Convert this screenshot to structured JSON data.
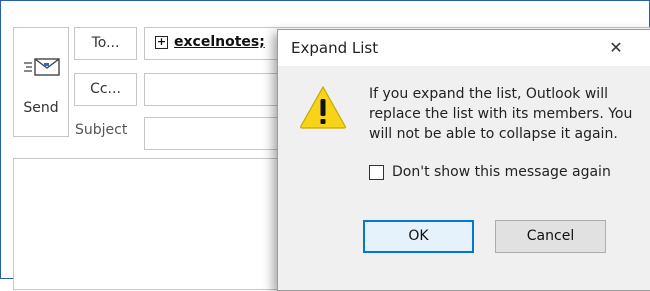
{
  "compose": {
    "send_label": "Send",
    "to_label": "To...",
    "cc_label": "Cc...",
    "subject_label": "Subject",
    "to_expand_glyph": "+",
    "to_value": "excelnotes;"
  },
  "dialog": {
    "title": "Expand List",
    "close_glyph": "✕",
    "message": "If you expand the list, Outlook will\nreplace the list with its members. You\nwill not be able to collapse it again.",
    "checkbox_label": "Don't show this message again",
    "checkbox_checked": false,
    "ok_label": "OK",
    "cancel_label": "Cancel"
  },
  "icons": {
    "send": "envelope-send-icon",
    "warning": "warning-triangle-icon"
  },
  "colors": {
    "frame_border": "#2a5fa8",
    "warning_fill": "#f7d417",
    "ok_border": "#0078d7"
  }
}
